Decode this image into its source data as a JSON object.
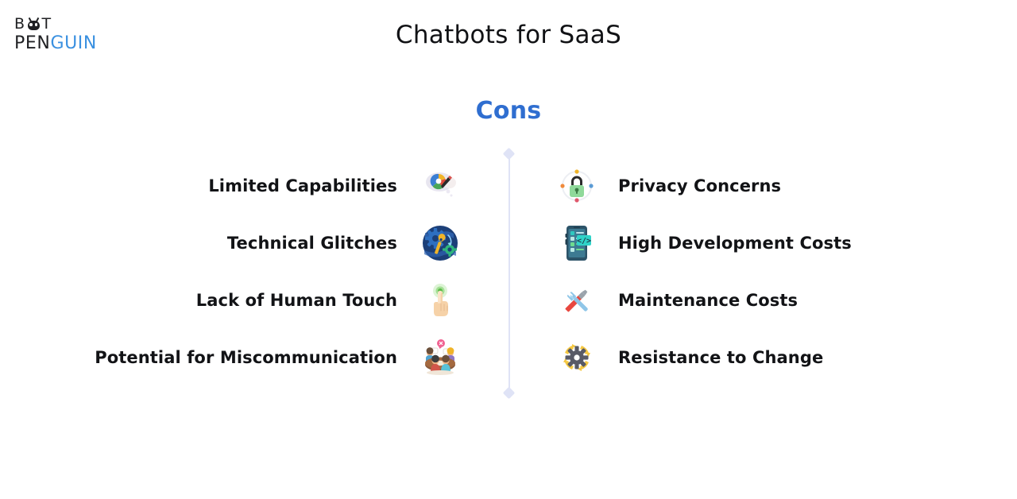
{
  "logo": {
    "line1_before": "B",
    "line1_after": "T",
    "line2_dark": "PEN",
    "line2_blue": "GUIN",
    "mark": "penguin-mark",
    "blue": "#3a90e0",
    "dark": "#1f2023"
  },
  "header": {
    "title": "Chatbots for SaaS"
  },
  "section": {
    "heading": "Cons",
    "heading_color": "#2f6ed0"
  },
  "divider": {
    "color": "#dfe3f6",
    "cap_shape": "diamond"
  },
  "columns": {
    "left": {
      "align": "right",
      "items": [
        {
          "label": "Limited Capabilities",
          "icon": "thought-bubble-chart-icon"
        },
        {
          "label": "Technical Glitches",
          "icon": "globe-gears-wrench-icon"
        },
        {
          "label": "Lack of Human Touch",
          "icon": "pointing-finger-touch-icon"
        },
        {
          "label": "Potential for Miscommunication",
          "icon": "meeting-table-people-icon"
        }
      ]
    },
    "right": {
      "align": "left",
      "items": [
        {
          "label": "Privacy Concerns",
          "icon": "padlock-orbit-icon"
        },
        {
          "label": "High Development Costs",
          "icon": "phone-code-icon"
        },
        {
          "label": "Maintenance Costs",
          "icon": "wrench-screwdriver-icon"
        },
        {
          "label": "Resistance to Change",
          "icon": "gear-arrows-icon"
        }
      ]
    }
  },
  "theme": {
    "background": "#ffffff",
    "text": "#121316",
    "title_color": "#111215"
  }
}
